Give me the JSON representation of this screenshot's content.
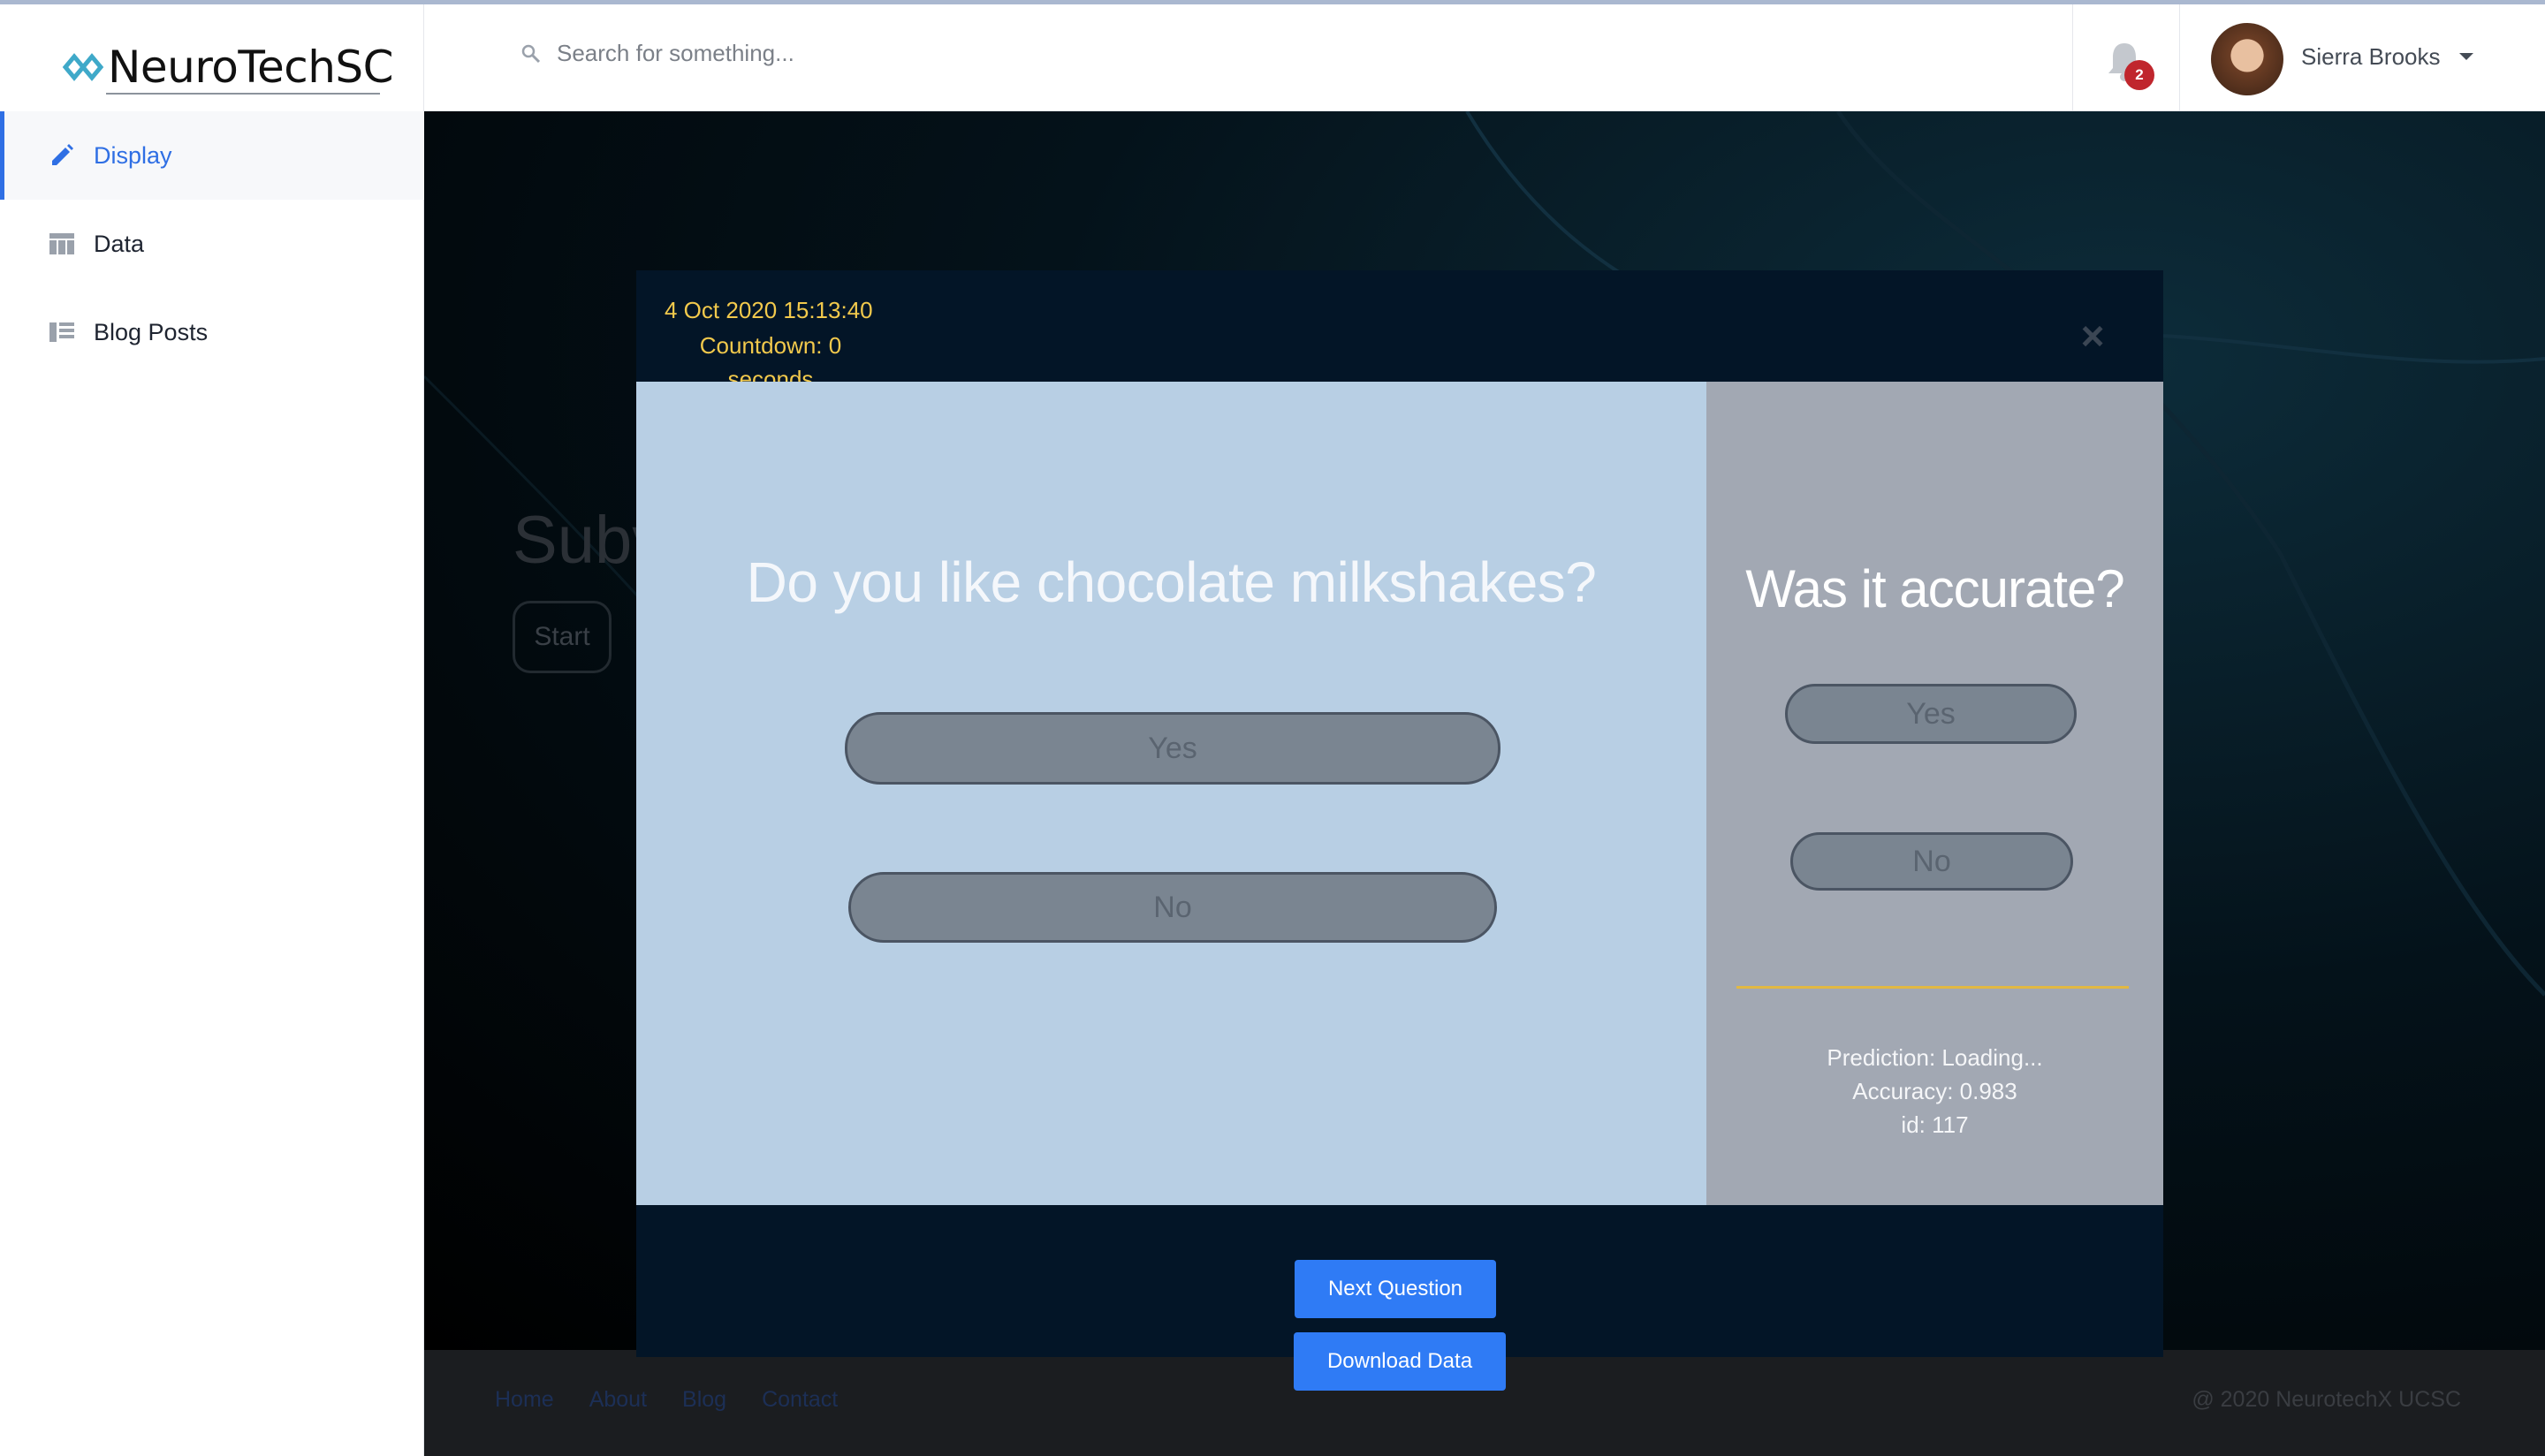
{
  "app": {
    "name": "NeuroTechSC"
  },
  "sidebar": {
    "items": [
      {
        "label": "Display",
        "icon": "pencil-icon",
        "active": true
      },
      {
        "label": "Data",
        "icon": "table-icon",
        "active": false
      },
      {
        "label": "Blog Posts",
        "icon": "list-icon",
        "active": false
      }
    ]
  },
  "header": {
    "search_placeholder": "Search for something...",
    "notifications_count": "2",
    "user_name": "Sierra Brooks"
  },
  "background": {
    "title": "Subv",
    "start_label": "Start"
  },
  "footer": {
    "links": [
      "Home",
      "About",
      "Blog",
      "Contact"
    ],
    "copyright": "@ 2020 NeurotechX UCSC"
  },
  "modal": {
    "datetime": "4 Oct 2020 15:13:40",
    "countdown": "Countdown: 0",
    "countdown_unit": "seconds",
    "question": "Do you like chocolate milkshakes?",
    "answer_yes": "Yes",
    "answer_no": "No",
    "accuracy_title": "Was it accurate?",
    "accuracy_yes": "Yes",
    "accuracy_no": "No",
    "prediction": "Prediction: Loading...",
    "accuracy": "Accuracy: 0.983",
    "id": "id: 117",
    "next_label": "Next Question",
    "download_label": "Download Data"
  },
  "colors": {
    "accent": "#2f6fe4",
    "button_blue": "#2f7bf5",
    "modal_bg": "#031527",
    "question_panel": "#b8cfe4",
    "answer_panel": "#a2a8b3",
    "highlight_yellow": "#f2c94c",
    "badge_red": "#c0262d"
  }
}
